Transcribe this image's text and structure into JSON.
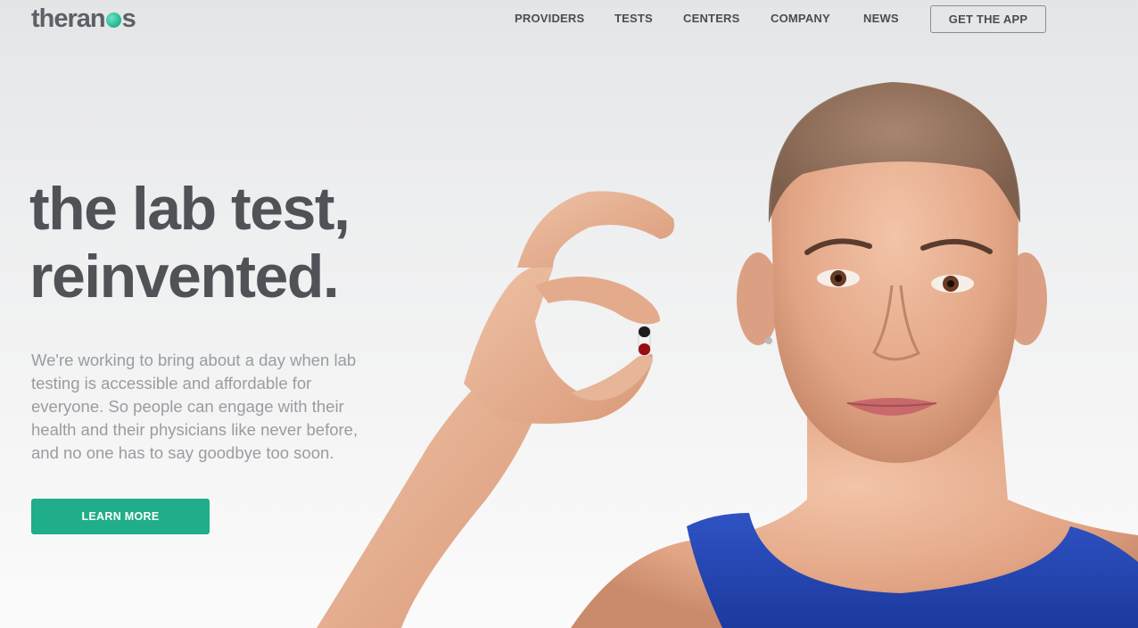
{
  "brand": {
    "logo_prefix": "theran",
    "logo_suffix": "s",
    "accent_color": "#1fae89"
  },
  "nav": {
    "items": [
      {
        "label": "PROVIDERS"
      },
      {
        "label": "TESTS"
      },
      {
        "label": "CENTERS"
      },
      {
        "label": "COMPANY"
      },
      {
        "label": "NEWS"
      }
    ],
    "cta_label": "GET THE APP"
  },
  "hero": {
    "headline_line1": "the lab test,",
    "headline_line2": "reinvented.",
    "body": "We're working to bring about a day when lab testing is accessible and affordable for everyone. So people can engage with their health and their physicians like never before, and no one has to say goodbye too soon.",
    "button_label": "LEARN MORE",
    "photo_subject": "woman holding small blood sample capsule"
  }
}
